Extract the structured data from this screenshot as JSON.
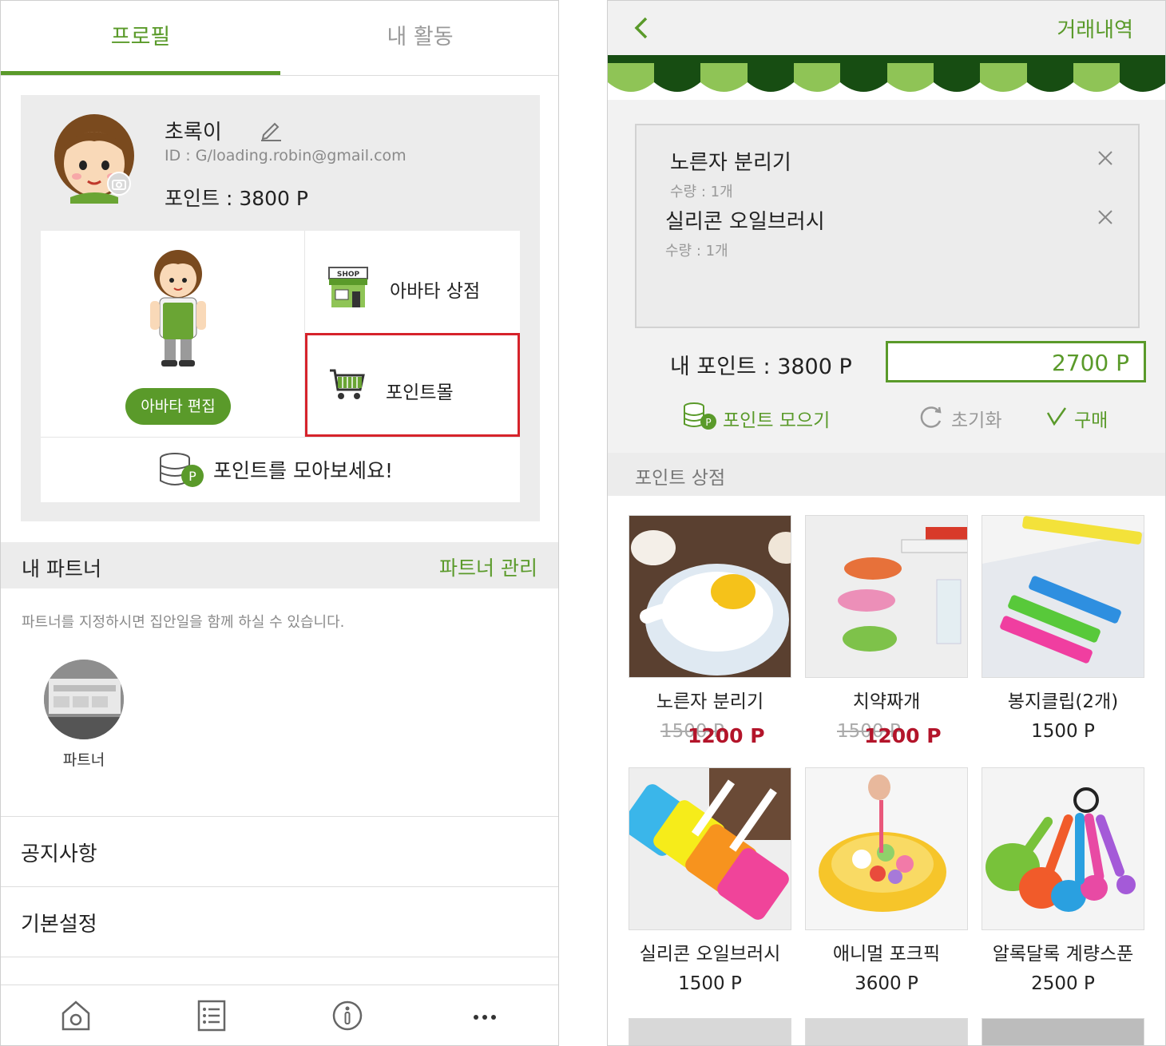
{
  "left": {
    "tabs": [
      {
        "label": "프로필",
        "active": true
      },
      {
        "label": "내 활동",
        "active": false
      }
    ],
    "profile": {
      "nickname": "초록이",
      "user_id": "ID : G/loading.robin@gmail.com",
      "points": "포인트 : 3800 P"
    },
    "menu": {
      "avatar_edit": "아바타 편집",
      "avatar_shop": "아바타 상점",
      "avatar_shop_sign": "SHOP",
      "point_mall": "포인트몰",
      "collect_points": "포인트를 모아보세요!",
      "coin_badge": "P"
    },
    "partner": {
      "title": "내 파트너",
      "manage": "파트너 관리",
      "description": "파트너를 지정하시면 집안일을 함께 하실 수 있습니다.",
      "name": "파트너"
    },
    "list": {
      "notice": "공지사항",
      "settings": "기본설정"
    },
    "bottom_nav": [
      "home-icon",
      "list-icon",
      "info-icon",
      "more-icon"
    ]
  },
  "right": {
    "header": {
      "history": "거래내역"
    },
    "cart": [
      {
        "name": "노른자 분리기",
        "qty": "수량 : 1개"
      },
      {
        "name": "실리콘 오일브러시",
        "qty": "수량 : 1개"
      }
    ],
    "my_points": "내 포인트 : 3800 P",
    "total": "2700 P",
    "actions": {
      "collect": "포인트 모으기",
      "reset": "초기화",
      "buy": "구매"
    },
    "store_title": "포인트 상점",
    "products": [
      {
        "name": "노른자 분리기",
        "old_price": "1500 P",
        "price": "1200 P",
        "sale": true
      },
      {
        "name": "치약짜개",
        "old_price": "1500 P",
        "price": "1200 P",
        "sale": true
      },
      {
        "name": "봉지클립(2개)",
        "price": "1500 P",
        "sale": false
      },
      {
        "name": "실리콘 오일브러시",
        "price": "1500 P",
        "sale": false
      },
      {
        "name": "애니멀 포크픽",
        "price": "3600 P",
        "sale": false
      },
      {
        "name": "알록달록 계량스푼",
        "price": "2500 P",
        "sale": false
      }
    ]
  },
  "colors": {
    "brand_green": "#5a9a2a",
    "highlight_red": "#d6232b",
    "sale_red": "#b3142a"
  }
}
